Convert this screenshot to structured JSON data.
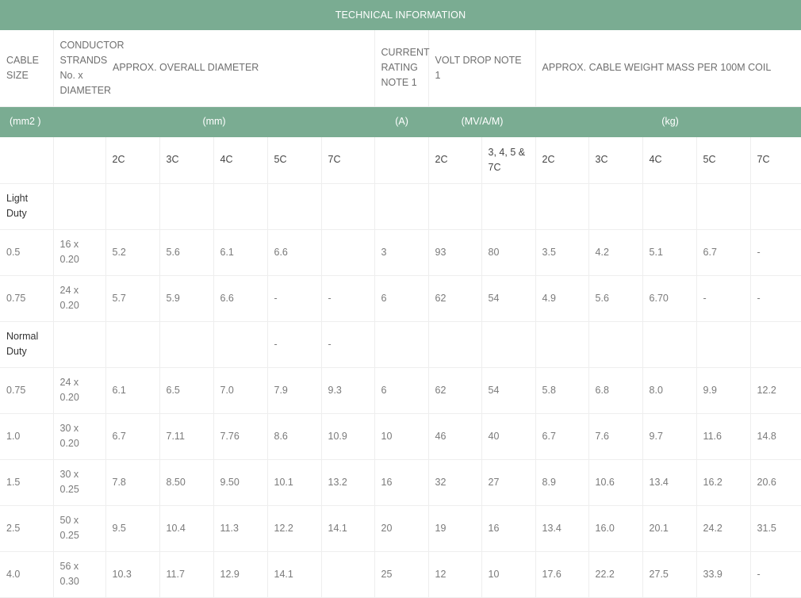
{
  "title": "TECHNICAL INFORMATION",
  "headers": {
    "cable_size": "CABLE SIZE",
    "conductor": "CONDUCTOR STRANDS No. x DIAMETER",
    "diameter": "APPROX. OVERALL DIAMETER",
    "current_rating": "CURRENT RATING NOTE 1",
    "volt_drop": "VOLT DROP NOTE 1",
    "weight": "APPROX. CABLE WEIGHT MASS PER 100M COIL"
  },
  "units": {
    "size": "(mm2 )",
    "diameter": "(mm)",
    "current": "(A)",
    "volt_drop": "(MV/A/M)",
    "weight": "(kg)"
  },
  "subheaders": [
    "",
    "",
    "2C",
    "3C",
    "4C",
    "5C",
    "7C",
    "",
    "2C",
    "3, 4, 5 & 7C",
    "2C",
    "3C",
    "4C",
    "5C",
    "7C"
  ],
  "sections": [
    {
      "label": "Light Duty",
      "label_row": [
        "Light Duty",
        "",
        "",
        "",
        "",
        "",
        "",
        "",
        "",
        "",
        "",
        "",
        "",
        "",
        ""
      ],
      "rows": [
        [
          "0.5",
          "16 x 0.20",
          "5.2",
          "5.6",
          "6.1",
          "6.6",
          "",
          "3",
          "93",
          "80",
          "3.5",
          "4.2",
          "5.1",
          "6.7",
          "-"
        ],
        [
          "0.75",
          "24 x 0.20",
          "5.7",
          "5.9",
          "6.6",
          "-",
          "-",
          "6",
          "62",
          "54",
          "4.9",
          "5.6",
          "6.70",
          "-",
          "-"
        ]
      ]
    },
    {
      "label": "Normal Duty",
      "label_row": [
        "Normal Duty",
        "",
        "",
        "",
        "",
        "-",
        "-",
        "",
        "",
        "",
        "",
        "",
        "",
        "",
        ""
      ],
      "rows": [
        [
          "0.75",
          "24 x 0.20",
          "6.1",
          "6.5",
          "7.0",
          "7.9",
          "9.3",
          "6",
          "62",
          "54",
          "5.8",
          "6.8",
          "8.0",
          "9.9",
          "12.2"
        ],
        [
          "1.0",
          "30 x 0.20",
          "6.7",
          "7.11",
          "7.76",
          "8.6",
          "10.9",
          "10",
          "46",
          "40",
          "6.7",
          "7.6",
          "9.7",
          "11.6",
          "14.8"
        ],
        [
          "1.5",
          "30 x 0.25",
          "7.8",
          "8.50",
          "9.50",
          "10.1",
          "13.2",
          "16",
          "32",
          "27",
          "8.9",
          "10.6",
          "13.4",
          "16.2",
          "20.6"
        ],
        [
          "2.5",
          "50 x 0.25",
          "9.5",
          "10.4",
          "11.3",
          "12.2",
          "14.1",
          "20",
          "19",
          "16",
          "13.4",
          "16.0",
          "20.1",
          "24.2",
          "31.5"
        ],
        [
          "4.0",
          "56 x 0.30",
          "10.3",
          "11.7",
          "12.9",
          "14.1",
          "",
          "25",
          "12",
          "10",
          "17.6",
          "22.2",
          "27.5",
          "33.9",
          "-"
        ]
      ]
    }
  ]
}
